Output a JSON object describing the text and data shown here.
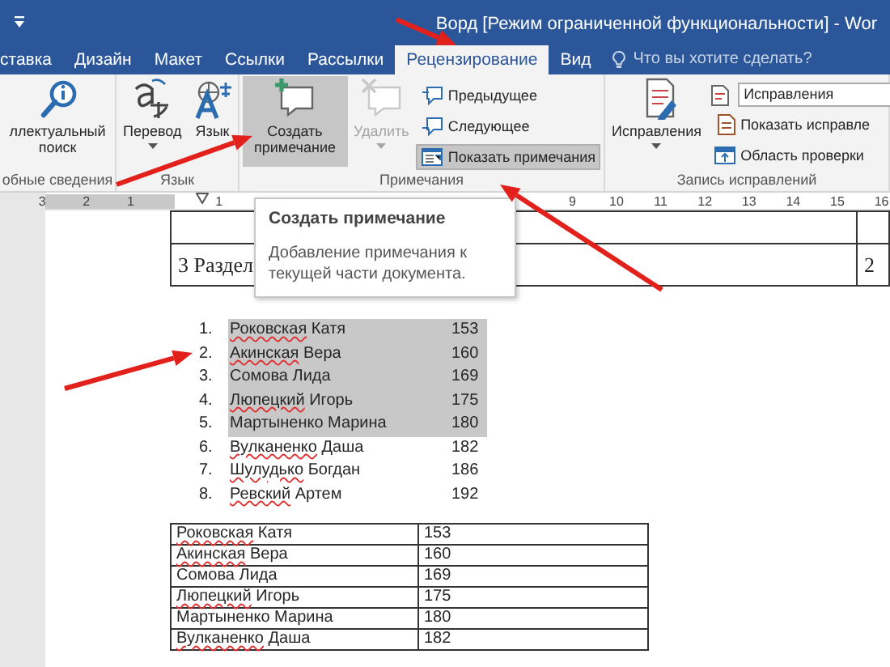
{
  "window": {
    "title": "Ворд [Режим ограниченной функциональности] - Wor"
  },
  "tabs": [
    {
      "label": "ставка",
      "selected": false
    },
    {
      "label": "Дизайн",
      "selected": false
    },
    {
      "label": "Макет",
      "selected": false
    },
    {
      "label": "Ссылки",
      "selected": false
    },
    {
      "label": "Рассылки",
      "selected": false
    },
    {
      "label": "Рецензирование",
      "selected": true
    },
    {
      "label": "Вид",
      "selected": false
    }
  ],
  "tell_me": {
    "placeholder": "Что вы хотите сделать?"
  },
  "ribbon": {
    "groups": [
      {
        "label": "обные сведения",
        "items": [
          {
            "kind": "large",
            "label": "ллектуальный поиск",
            "highlighted": false,
            "disabled": false,
            "pressed": false,
            "dropdown": false
          }
        ]
      },
      {
        "label": "Язык",
        "items": [
          {
            "kind": "large",
            "label": "Перевод",
            "highlighted": false,
            "disabled": false,
            "pressed": false,
            "dropdown": true
          },
          {
            "kind": "large",
            "label": "Язык",
            "highlighted": false,
            "disabled": false,
            "pressed": false,
            "dropdown": false
          }
        ]
      },
      {
        "label": "Примечания",
        "items": [
          {
            "kind": "large",
            "label": "Создать примечание",
            "highlighted": true,
            "disabled": false,
            "pressed": false,
            "dropdown": false
          },
          {
            "kind": "large",
            "label": "Удалить",
            "highlighted": false,
            "disabled": true,
            "pressed": false,
            "dropdown": true
          },
          {
            "kind": "small",
            "label": "Предыдущее",
            "highlighted": false,
            "disabled": false,
            "pressed": false
          },
          {
            "kind": "small",
            "label": "Следующее",
            "highlighted": false,
            "disabled": false,
            "pressed": false
          },
          {
            "kind": "small",
            "label": "Показать примечания",
            "highlighted": false,
            "disabled": false,
            "pressed": true
          }
        ]
      },
      {
        "label": "Запись исправлений",
        "items": [
          {
            "kind": "large",
            "label": "Исправления",
            "highlighted": false,
            "disabled": false,
            "pressed": false,
            "dropdown": true
          },
          {
            "kind": "combo",
            "value": "Исправления"
          },
          {
            "kind": "small",
            "label": "Показать исправле",
            "highlighted": false,
            "disabled": false,
            "pressed": false
          },
          {
            "kind": "small",
            "label": "Область проверки",
            "highlighted": false,
            "disabled": false,
            "pressed": false
          }
        ]
      }
    ]
  },
  "ruler": {
    "marks": [
      "3",
      "2",
      "1",
      "1",
      "9",
      "10",
      "11",
      "12",
      "13",
      "14",
      "15",
      "16"
    ]
  },
  "tooltip": {
    "title": "Создать примечание",
    "text": "Добавление примечания к текущей части документа."
  },
  "document": {
    "top_table": {
      "rows": [
        {
          "cells": [
            "3 Раздел",
            "2"
          ]
        }
      ]
    },
    "list": [
      {
        "number": "1.",
        "name": "Роковская Катя",
        "value": "153",
        "selected": true,
        "misspelled": true
      },
      {
        "number": "2.",
        "name": "Акинская Вера",
        "value": "160",
        "selected": true,
        "misspelled": true
      },
      {
        "number": "3.",
        "name": "Сомова Лида",
        "value": "169",
        "selected": true,
        "misspelled": false
      },
      {
        "number": "4.",
        "name": "Люпецкий Игорь",
        "value": "175",
        "selected": true,
        "misspelled": true
      },
      {
        "number": "5.",
        "name": "Мартыненко Марина",
        "value": "180",
        "selected": true,
        "misspelled": false
      },
      {
        "number": "6.",
        "name": "Вулканенко Даша",
        "value": "182",
        "selected": false,
        "misspelled": true
      },
      {
        "number": "7.",
        "name": "Шулудько Богдан",
        "value": "186",
        "selected": false,
        "misspelled": true
      },
      {
        "number": "8.",
        "name": "Ревский Артем",
        "value": "192",
        "selected": false,
        "misspelled": true
      }
    ],
    "table": {
      "rows": [
        {
          "name": "Роковская Катя",
          "value": "153",
          "misspelled": true
        },
        {
          "name": "Акинская Вера",
          "value": "160",
          "misspelled": true
        },
        {
          "name": "Сомова Лида",
          "value": "169",
          "misspelled": false
        },
        {
          "name": "Люпецкий Игорь",
          "value": "175",
          "misspelled": true
        },
        {
          "name": "Мартыненко Марина",
          "value": "180",
          "misspelled": false
        },
        {
          "name": "Вулканенко Даша",
          "value": "182",
          "misspelled": true
        }
      ]
    }
  }
}
